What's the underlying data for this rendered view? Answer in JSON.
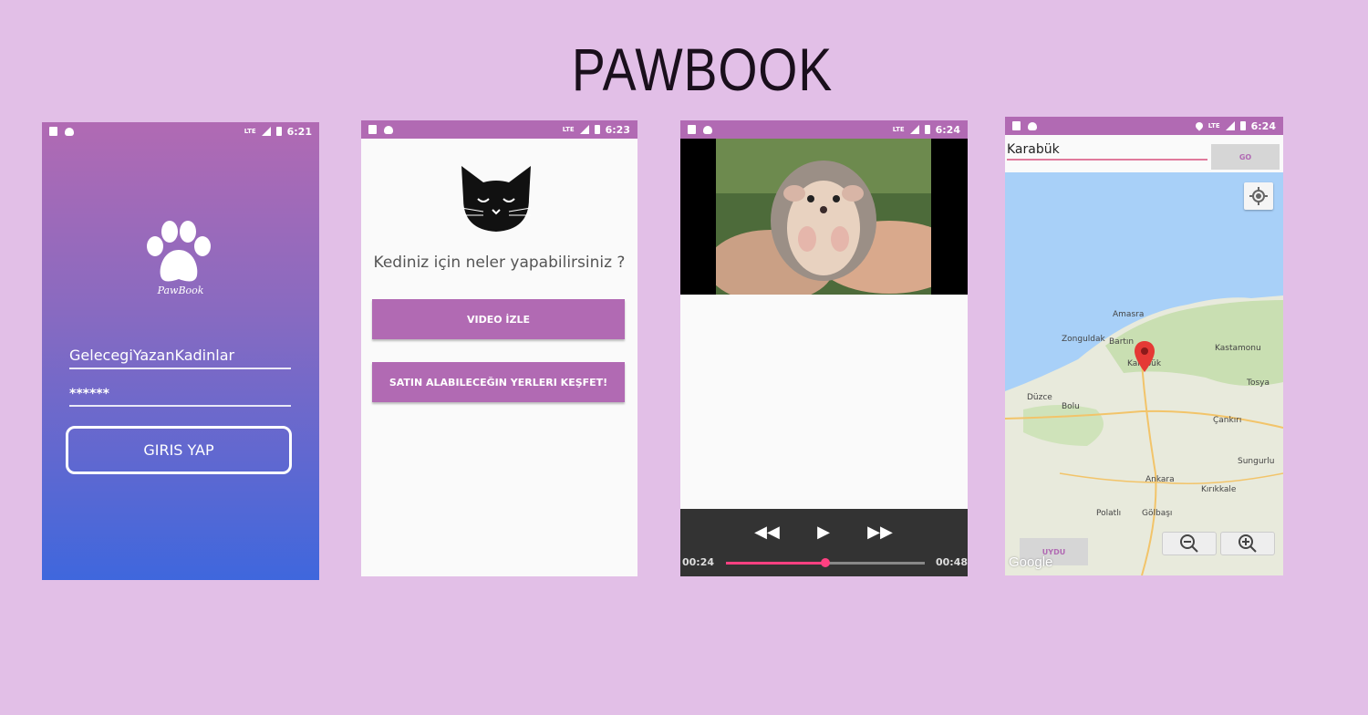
{
  "title": "PAWBOOK",
  "colors": {
    "background": "#e2bfe7",
    "accent": "#b16ab3",
    "seek": "#ff4081",
    "gradient_end": "#3f67dd"
  },
  "screens": {
    "login": {
      "time": "6:21",
      "logo_text": "PawBook",
      "username": "GelecegiYazanKadinlar",
      "password": "******",
      "login_button": "GIRIS YAP"
    },
    "menu": {
      "time": "6:23",
      "question": "Kediniz için neler yapabilirsiniz ?",
      "video_button": "VIDEO İZLE",
      "discover_button": "SATIN ALABILECEĞIN YERLERI KEŞFET!"
    },
    "video": {
      "time": "6:24",
      "current_time": "00:24",
      "total_time": "00:48",
      "progress": 0.5
    },
    "map": {
      "time": "6:24",
      "search_value": "Karabük",
      "go_button": "GO",
      "satellite_button": "UYDU",
      "google_label": "Google",
      "places": [
        "Amasra",
        "Zonguldak",
        "Bartın",
        "Karabük",
        "Kastamonu",
        "Düzce",
        "Bolu",
        "Tosya",
        "Çankırı",
        "Sungurlu",
        "Ankara",
        "Kırıkkale",
        "Polatlı",
        "Gölbaşı"
      ]
    }
  }
}
